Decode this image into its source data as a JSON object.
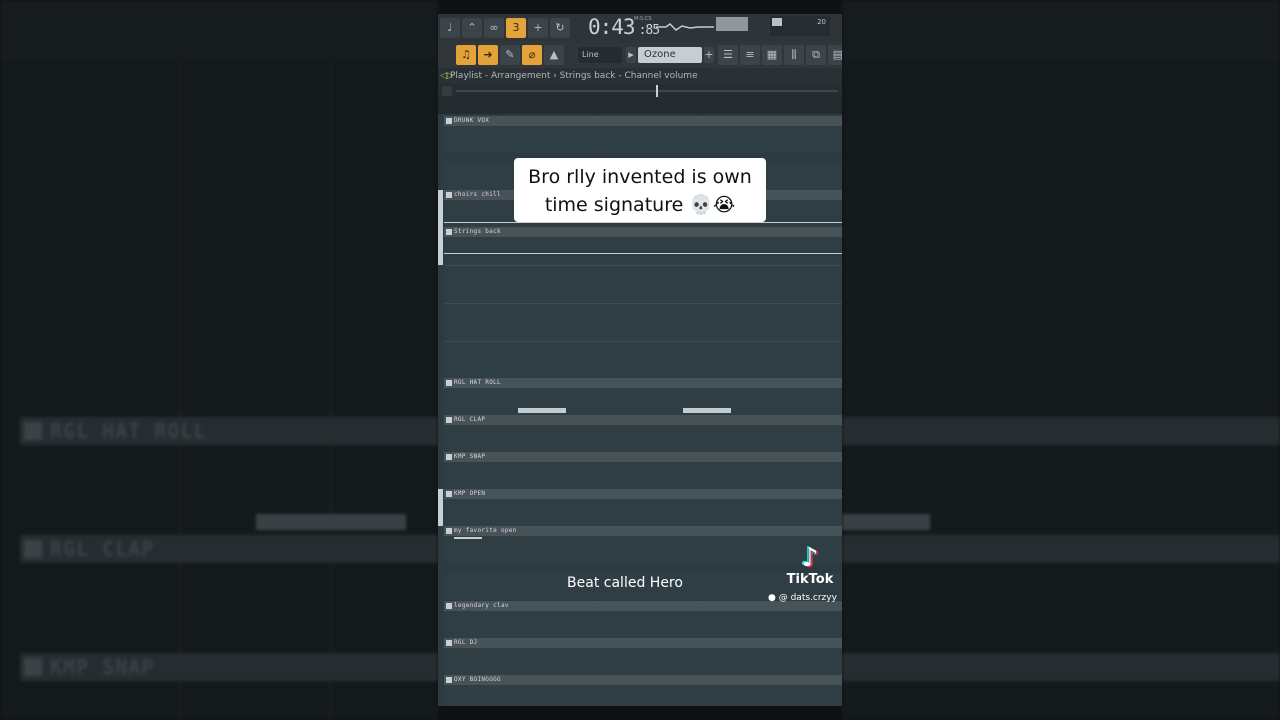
{
  "left_blur_labels": [
    "RGL HAT ROLL",
    "RGL CLAP",
    "KMP SNAP"
  ],
  "toolbar": {
    "time_main": "0:43",
    "time_sub": "85",
    "time_format": "M:S:CS",
    "mini_value": "20",
    "snap_label": "Line",
    "channel_label": "Ozone comp",
    "add_label": "+"
  },
  "breadcrumb": "Playlist - Arrangement › Strings back - Channel volume",
  "tracks": [
    {
      "label": "DRUNK VOX"
    },
    {
      "label": "choirs chill"
    },
    {
      "label": "Strings back"
    },
    {
      "label": "RGL HAT ROLL"
    },
    {
      "label": "RGL CLAP"
    },
    {
      "label": "KMP SNAP"
    },
    {
      "label": "KMP OPEN"
    },
    {
      "label": "my favorite open"
    },
    {
      "label": "legendary clav"
    },
    {
      "label": "RGL DJ"
    },
    {
      "label": "OXY BOINGGGG"
    }
  ],
  "overlay": {
    "caption": "Bro rlly invented is own time signature 💀😭",
    "bottom_text": "Beat called Hero",
    "tiktok_brand": "TikTok",
    "handle": "@ dats.crzyy"
  },
  "colors": {
    "accent": "#e3a33a",
    "lane_body": "#2f3d45",
    "lane_header": "#485358"
  }
}
